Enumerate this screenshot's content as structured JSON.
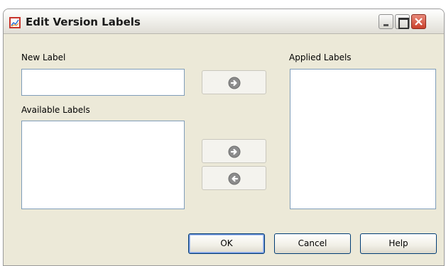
{
  "window": {
    "title": "Edit Version Labels"
  },
  "title_bar_buttons": {
    "minimize": "minimize-icon",
    "maximize": "maximize-icon",
    "close": "close-icon"
  },
  "new_label": {
    "label": "New Label",
    "value": ""
  },
  "available_labels": {
    "label": "Available Labels",
    "items": []
  },
  "applied_labels": {
    "label": "Applied Labels",
    "items": []
  },
  "transfer_buttons": {
    "add_new": "arrow-right-icon",
    "add_available": "arrow-right-icon",
    "remove_applied": "arrow-left-icon"
  },
  "footer": {
    "ok_label": "OK",
    "cancel_label": "Cancel",
    "help_label": "Help"
  },
  "colors": {
    "window_bg": "#ece9d8",
    "field_border": "#7f9db9",
    "accent_red": "#c8342c"
  }
}
